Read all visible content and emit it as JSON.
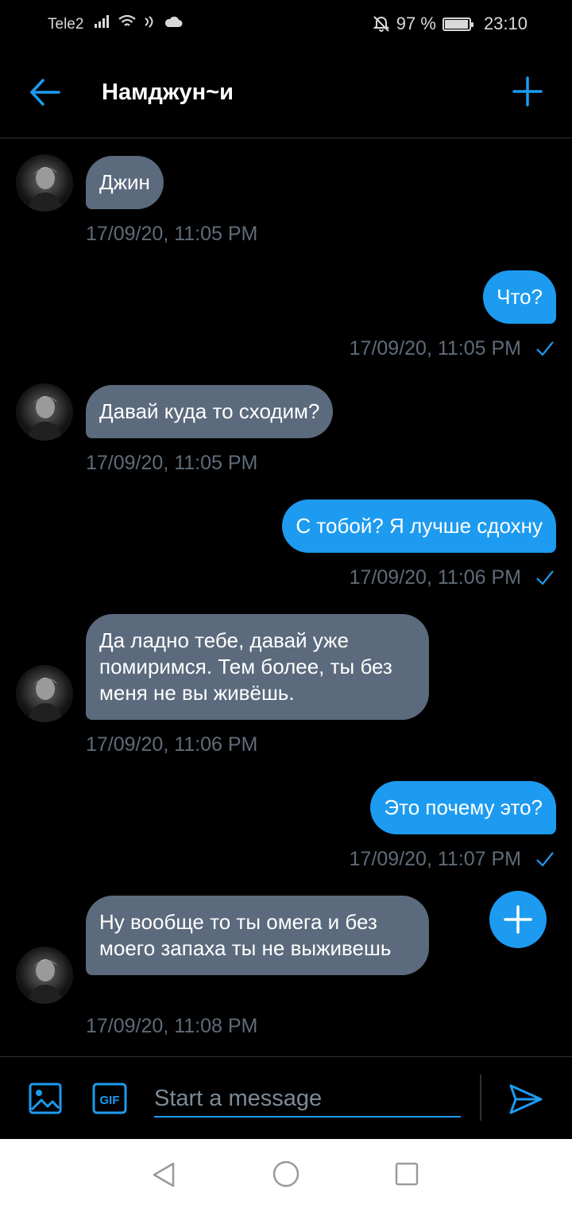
{
  "status_bar": {
    "carrier": "Tele2",
    "battery": "97 %",
    "battery_level": 0.97,
    "time": "23:10",
    "icons": [
      "signal-icon",
      "wifi-icon",
      "nfc-icon",
      "cloud-icon",
      "mute-icon",
      "battery-icon"
    ]
  },
  "header": {
    "title": "Намджун~и",
    "back_icon": "arrow-left-icon",
    "action_icon": "plus-icon"
  },
  "messages": [
    {
      "direction": "in",
      "text": "Джин",
      "time": "17/09/20, 11:05 PM"
    },
    {
      "direction": "out",
      "text": "Что?",
      "time": "17/09/20, 11:05 PM",
      "read": true
    },
    {
      "direction": "in",
      "text": "Давай куда то сходим?",
      "time": "17/09/20, 11:05 PM"
    },
    {
      "direction": "out",
      "text": "С тобой? Я лучше сдохну",
      "time": "17/09/20, 11:06 PM",
      "read": true
    },
    {
      "direction": "in",
      "text": "Да ладно тебе, давай уже помиримся. Тем более, ты без меня не вы живёшь.",
      "time": "17/09/20, 11:06 PM"
    },
    {
      "direction": "out",
      "text": "Это почему это?",
      "time": "17/09/20, 11:07 PM",
      "read": true
    },
    {
      "direction": "in",
      "text": "Ну вообще то ты омега и без моего запаха ты не выживешь",
      "time": "17/09/20, 11:08 PM"
    }
  ],
  "composer": {
    "placeholder": "Start a message",
    "gif_label": "GIF",
    "icons": [
      "image-icon",
      "gif-icon",
      "send-icon"
    ]
  },
  "fab_icon": "plus-icon",
  "colors": {
    "accent": "#1d9bf0",
    "incoming_bubble": "#5b6a7c",
    "background": "#000000",
    "timestamp": "#5f6b78"
  }
}
